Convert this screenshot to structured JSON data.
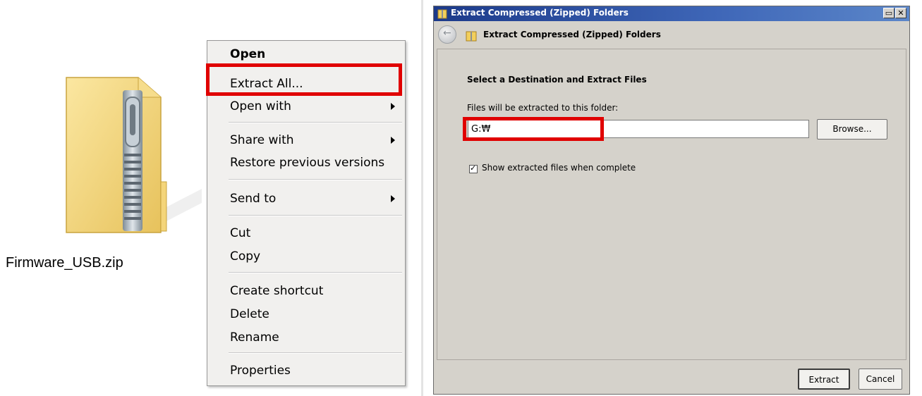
{
  "file": {
    "name": "Firmware_USB.zip"
  },
  "context_menu": {
    "items": [
      {
        "label": "Open"
      },
      {
        "label": "Extract All..."
      },
      {
        "label": "Open with"
      },
      {
        "label": "Share with"
      },
      {
        "label": "Restore previous versions"
      },
      {
        "label": "Send to"
      },
      {
        "label": "Cut"
      },
      {
        "label": "Copy"
      },
      {
        "label": "Create shortcut"
      },
      {
        "label": "Delete"
      },
      {
        "label": "Rename"
      },
      {
        "label": "Properties"
      }
    ],
    "highlight_color": "#e00000"
  },
  "dialog": {
    "window_title": "Extract Compressed (Zipped) Folders",
    "header_title": "Extract Compressed (Zipped) Folders",
    "section_heading": "Select a Destination and Extract Files",
    "destination_label": "Files will be extracted to this folder:",
    "destination_value": "G:₩",
    "browse_label": "Browse...",
    "show_files_label": "Show extracted files when complete",
    "show_files_checked": true,
    "extract_label": "Extract",
    "cancel_label": "Cancel",
    "titlebar_color": "#1c3a8a",
    "body_color": "#d5d2cb"
  },
  "icons": [
    "zip-folder-icon",
    "folder-icon",
    "back-arrow-icon",
    "restore-icon",
    "close-icon",
    "submenu-arrow-icon",
    "checkmark-icon"
  ]
}
